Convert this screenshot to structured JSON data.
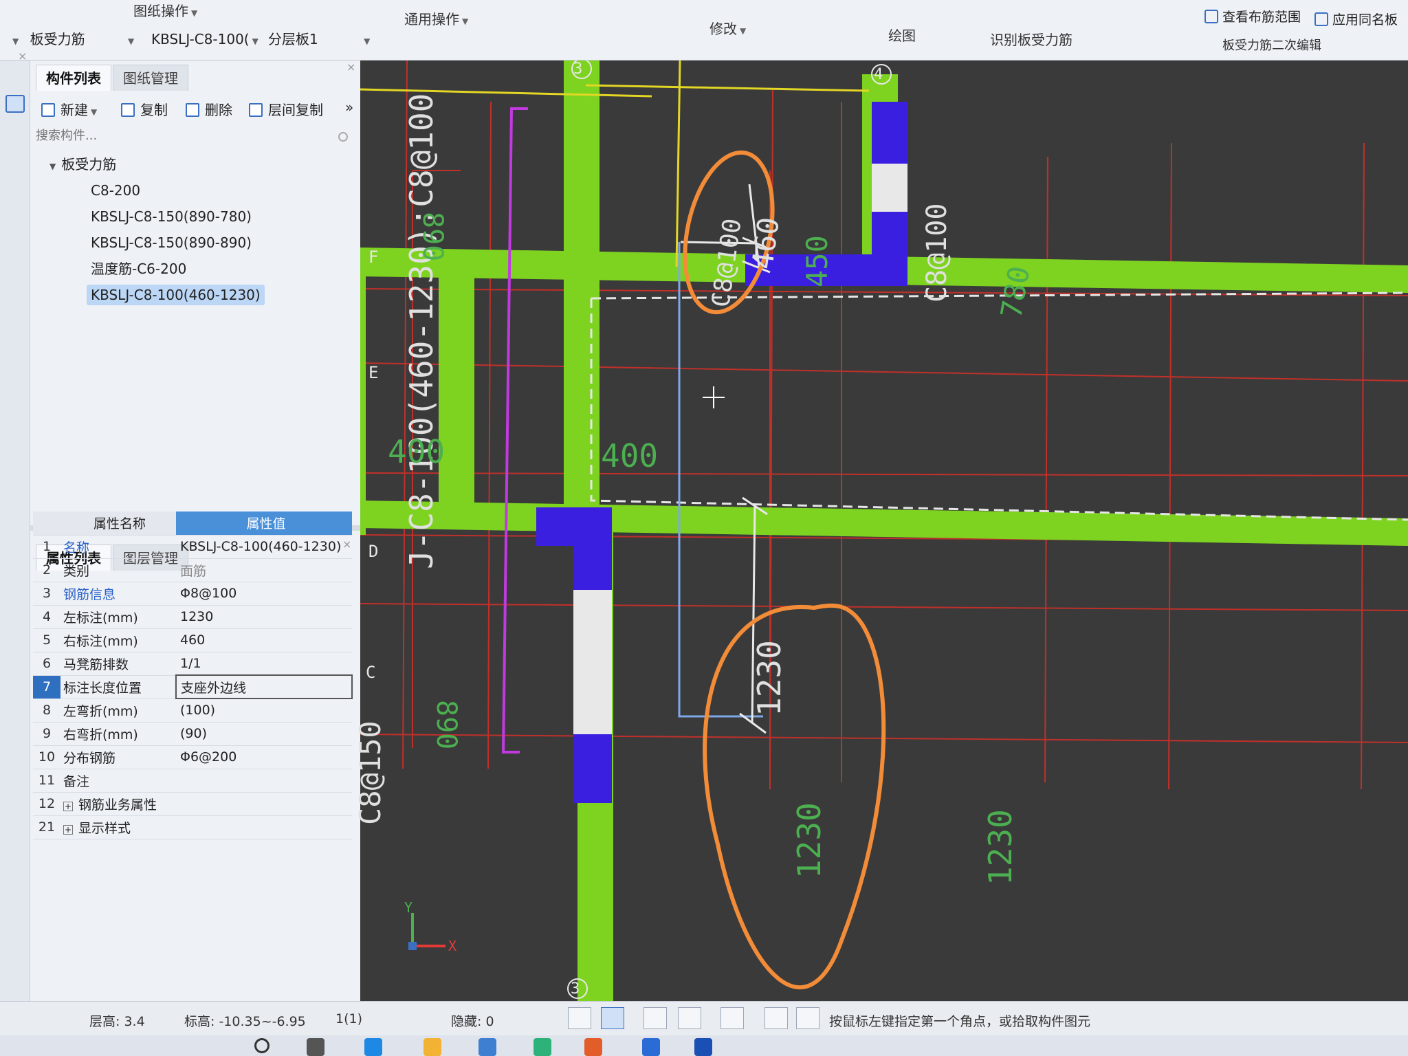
{
  "ribbon": {
    "drawing_ops": "图纸操作",
    "general_ops": "通用操作",
    "modify": "修改",
    "draw": "绘图",
    "identify": "识别板受力筋",
    "secondary_edit": "板受力筋二次编辑",
    "view_range": "查看布筋范围",
    "apply_same": "应用同名板",
    "dropdown_type": "板受力筋",
    "dropdown_component": "KBSLJ-C8-100(",
    "dropdown_layer": "分层板1"
  },
  "component_panel": {
    "tabs": [
      "构件列表",
      "图纸管理"
    ],
    "toolbar": {
      "new": "新建",
      "copy": "复制",
      "delete": "删除",
      "floor_copy": "层间复制"
    },
    "search_placeholder": "搜索构件...",
    "tree_root": "板受力筋",
    "items": [
      "C8-200",
      "KBSLJ-C8-150(890-780)",
      "KBSLJ-C8-150(890-890)",
      "温度筋-C6-200",
      "KBSLJ-C8-100(460-1230)"
    ]
  },
  "property_panel": {
    "tabs": [
      "属性列表",
      "图层管理"
    ],
    "header_name": "属性名称",
    "header_value": "属性值",
    "rows": [
      {
        "num": "1",
        "name": "名称",
        "value": "KBSLJ-C8-100(460-1230)"
      },
      {
        "num": "2",
        "name": "类别",
        "value": "面筋"
      },
      {
        "num": "3",
        "name": "钢筋信息",
        "value": "Φ8@100"
      },
      {
        "num": "4",
        "name": "左标注(mm)",
        "value": "1230"
      },
      {
        "num": "5",
        "name": "右标注(mm)",
        "value": "460"
      },
      {
        "num": "6",
        "name": "马凳筋排数",
        "value": "1/1"
      },
      {
        "num": "7",
        "name": "标注长度位置",
        "value": "支座外边线"
      },
      {
        "num": "8",
        "name": "左弯折(mm)",
        "value": "(100)"
      },
      {
        "num": "9",
        "name": "右弯折(mm)",
        "value": "(90)"
      },
      {
        "num": "10",
        "name": "分布钢筋",
        "value": "Φ6@200"
      },
      {
        "num": "11",
        "name": "备注",
        "value": ""
      },
      {
        "num": "12",
        "name": "钢筋业务属性",
        "value": ""
      },
      {
        "num": "21",
        "name": "显示样式",
        "value": ""
      }
    ]
  },
  "canvas": {
    "axis_labels": {
      "col3_top": "3",
      "col4_top": "4",
      "col3_bottom": "3",
      "F": "F",
      "E": "E",
      "D": "D",
      "C": "C"
    },
    "rebar_main": "J-C8-100(460-1230):C8@100",
    "dim_460": "460",
    "label_c8100_top": "C8@100",
    "dim_1230": "1230",
    "label_c8100_right": "C8@100",
    "label_c8150": "C8@150",
    "green_890_a": "890",
    "green_890_b": "890",
    "green_400_a": "400",
    "green_400_b": "400",
    "green_450": "450",
    "green_780": "780",
    "green_1230_a": "1230",
    "green_1230_b": "1230",
    "axis_y": "Y",
    "axis_x": "X"
  },
  "statusbar": {
    "floor_height": "层高:  3.4",
    "elevation": "标高:  -10.35~-6.95",
    "count": "1(1)",
    "hidden": "隐藏:  0",
    "hint": "按鼠标左键指定第一个角点，或拾取构件图元"
  }
}
